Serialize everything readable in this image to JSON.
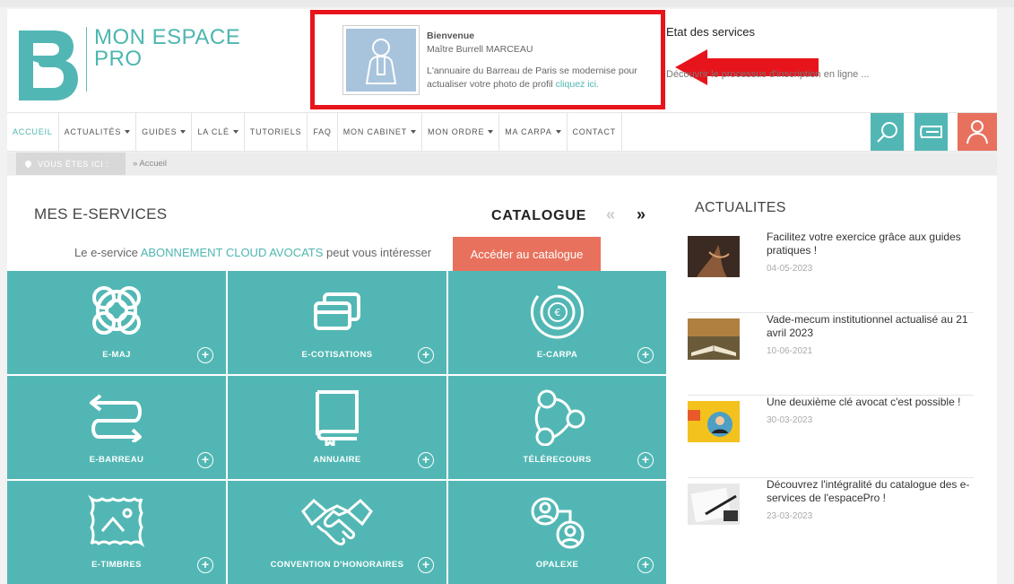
{
  "brand": {
    "line1": "MON ESPACE",
    "line2": "PRO"
  },
  "welcome": {
    "title": "Bienvenue",
    "name": "Maître Burrell MARCEAU",
    "message": "L'annuaire du Barreau de Paris se modernise pour actualiser votre photo de profil",
    "link": "cliquez ici."
  },
  "status": {
    "etat": "Etat des services",
    "decouvrir": "Découvrir le processus d'inscription en ligne ..."
  },
  "colors": {
    "accent": "#4db6b0",
    "tile": "#52b7b4",
    "highlight": "#e8141b",
    "cta": "#e8715e"
  },
  "nav": {
    "items": [
      {
        "label": "ACCUEIL",
        "dropdown": false,
        "active": true
      },
      {
        "label": "ACTUALITÉS",
        "dropdown": true
      },
      {
        "label": "GUIDES",
        "dropdown": true
      },
      {
        "label": "LA CLÉ",
        "dropdown": true
      },
      {
        "label": "TUTORIELS",
        "dropdown": false
      },
      {
        "label": "FAQ",
        "dropdown": false
      },
      {
        "label": "MON CABINET",
        "dropdown": true
      },
      {
        "label": "MON ORDRE",
        "dropdown": true
      },
      {
        "label": "MA CARPA",
        "dropdown": true
      },
      {
        "label": "CONTACT",
        "dropdown": false
      }
    ],
    "buttons": [
      "search-icon",
      "card-icon",
      "user-icon"
    ]
  },
  "breadcrumb": {
    "label": "VOUS ÊTES ICI :",
    "current": "» Accueil"
  },
  "eservices": {
    "title": "MES E-SERVICES",
    "catalogue": "CATALOGUE",
    "prev": "«",
    "next": "»",
    "promo_before": "Le e-service",
    "promo_highlight": "ABONNEMENT CLOUD AVOCATS",
    "promo_after": "peut vous intéresser",
    "promo_button": "Accéder au catalogue",
    "tiles": [
      {
        "label": "E-MAJ",
        "icon": "lifebuoy-icon"
      },
      {
        "label": "E-COTISATIONS",
        "icon": "cards-icon"
      },
      {
        "label": "E-CARPA",
        "icon": "euro-coin-icon"
      },
      {
        "label": "E-BARREAU",
        "icon": "exchange-arrows-icon"
      },
      {
        "label": "ANNUAIRE",
        "icon": "book-icon"
      },
      {
        "label": "TÉLÉRECOURS",
        "icon": "network-icon"
      },
      {
        "label": "E-TIMBRES",
        "icon": "stamp-icon"
      },
      {
        "label": "CONVENTION D'HONORAIRES",
        "icon": "handshake-icon"
      },
      {
        "label": "OPALEXE",
        "icon": "users-link-icon"
      }
    ]
  },
  "actualites": {
    "title": "ACTUALITES",
    "items": [
      {
        "title": "Facilitez votre exercice grâce aux guides pratiques !",
        "date": "04-05-2023"
      },
      {
        "title": "Vade-mecum institutionnel actualisé au 21 avril 2023",
        "date": "10-06-2021"
      },
      {
        "title": "Une deuxième clé avocat c'est possible !",
        "date": "30-03-2023"
      },
      {
        "title": "Découvrez l'intégralité du catalogue des e-services de l'espacePro !",
        "date": "23-03-2023"
      }
    ]
  }
}
